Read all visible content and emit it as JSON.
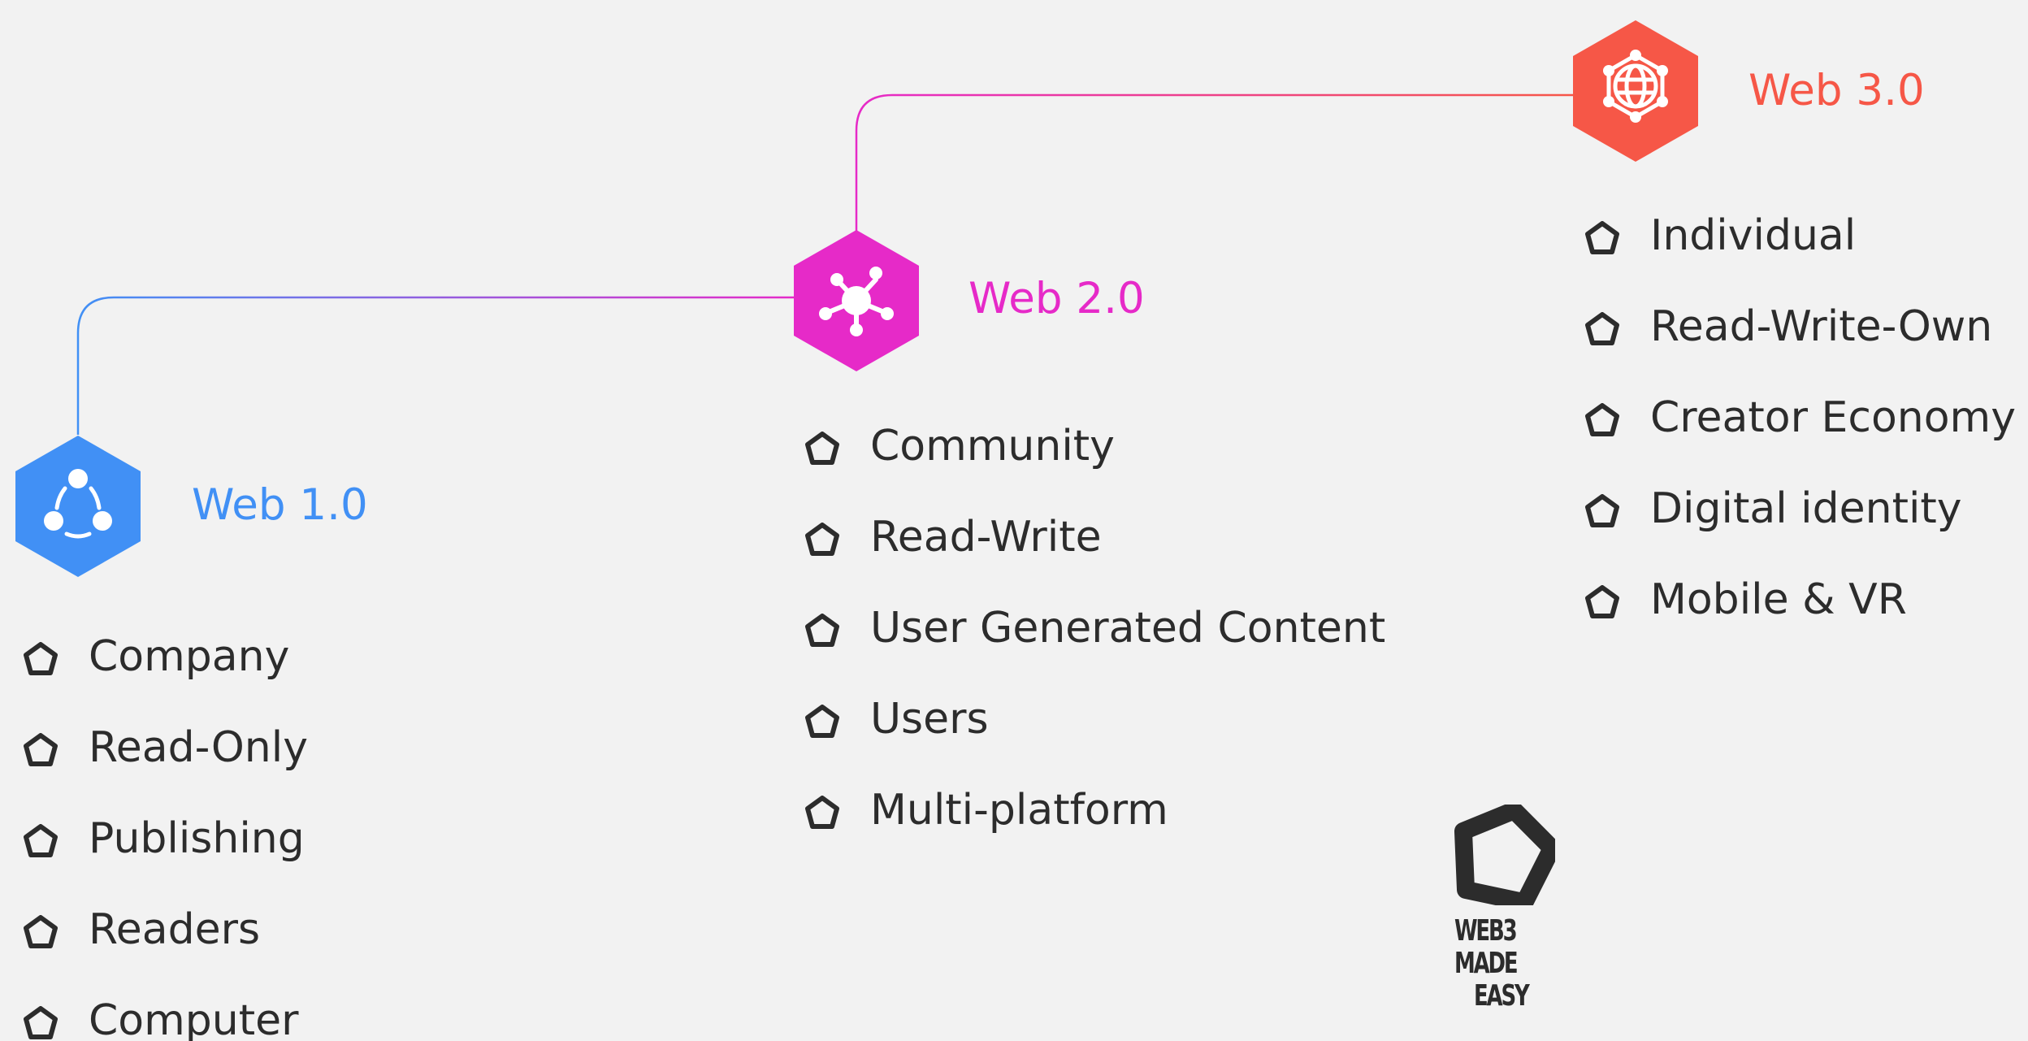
{
  "colors": {
    "background": "#f2f2f2",
    "web1": "#4190f5",
    "web2": "#e62ac8",
    "web3": "#f65747",
    "text": "#2c2c2c"
  },
  "stages": [
    {
      "title": "Web 1.0",
      "icon": "share-nodes-icon",
      "items": [
        "Company",
        "Read-Only",
        "Publishing",
        "Readers",
        "Computer"
      ]
    },
    {
      "title": "Web 2.0",
      "icon": "network-hub-icon",
      "items": [
        "Community",
        "Read-Write",
        "User Generated Content",
        "Users",
        "Multi-platform"
      ]
    },
    {
      "title": "Web 3.0",
      "icon": "globe-network-icon",
      "items": [
        "Individual",
        "Read-Write-Own",
        "Creator Economy",
        "Digital identity",
        "Mobile & VR"
      ]
    }
  ],
  "logo": {
    "icon": "pentagon-logo-icon",
    "lines": [
      "WEB3",
      "MADE",
      "EASY"
    ]
  }
}
